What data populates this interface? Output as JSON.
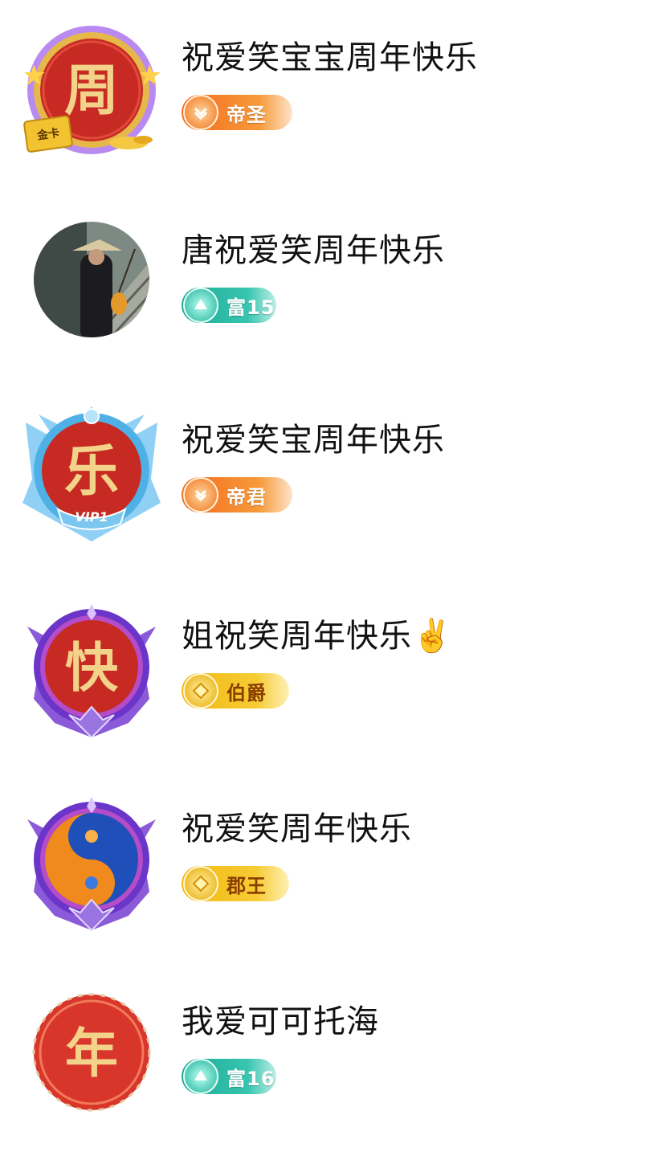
{
  "users": [
    {
      "name": "祝爱笑宝宝周年快乐",
      "avatar_char": "周",
      "avatar_style": "gold-card",
      "badge": {
        "label": "帝圣",
        "style": "orange",
        "icon": "wheat-icon"
      }
    },
    {
      "name": "唐祝爱笑周年快乐",
      "avatar_char": "",
      "avatar_style": "photo",
      "badge": {
        "label": "富15",
        "style": "teal",
        "icon": "diamond-icon"
      }
    },
    {
      "name": "祝爱笑宝周年快乐",
      "avatar_char": "乐",
      "avatar_style": "vip-blue",
      "avatar_sub": "VIP1",
      "badge": {
        "label": "帝君",
        "style": "orange",
        "icon": "chevron-icon"
      }
    },
    {
      "name": "姐祝笑周年快乐",
      "name_suffix": "✌️",
      "avatar_char": "快",
      "avatar_style": "purple-frame",
      "badge": {
        "label": "伯爵",
        "style": "gold",
        "icon": "gem-icon"
      }
    },
    {
      "name": "祝爱笑周年快乐",
      "avatar_char": "",
      "avatar_style": "yin-yang",
      "badge": {
        "label": "郡王",
        "style": "gold",
        "icon": "gem-icon"
      }
    },
    {
      "name": "我爱可可托海",
      "avatar_char": "年",
      "avatar_style": "red-plain",
      "badge": {
        "label": "富16",
        "style": "teal",
        "icon": "diamond-icon"
      }
    }
  ],
  "colors": {
    "accent_red": "#c62a22",
    "gold_text": "#f3d28a",
    "purple_frame": "#6a35c8",
    "blue_frame": "#4fb0e6"
  }
}
